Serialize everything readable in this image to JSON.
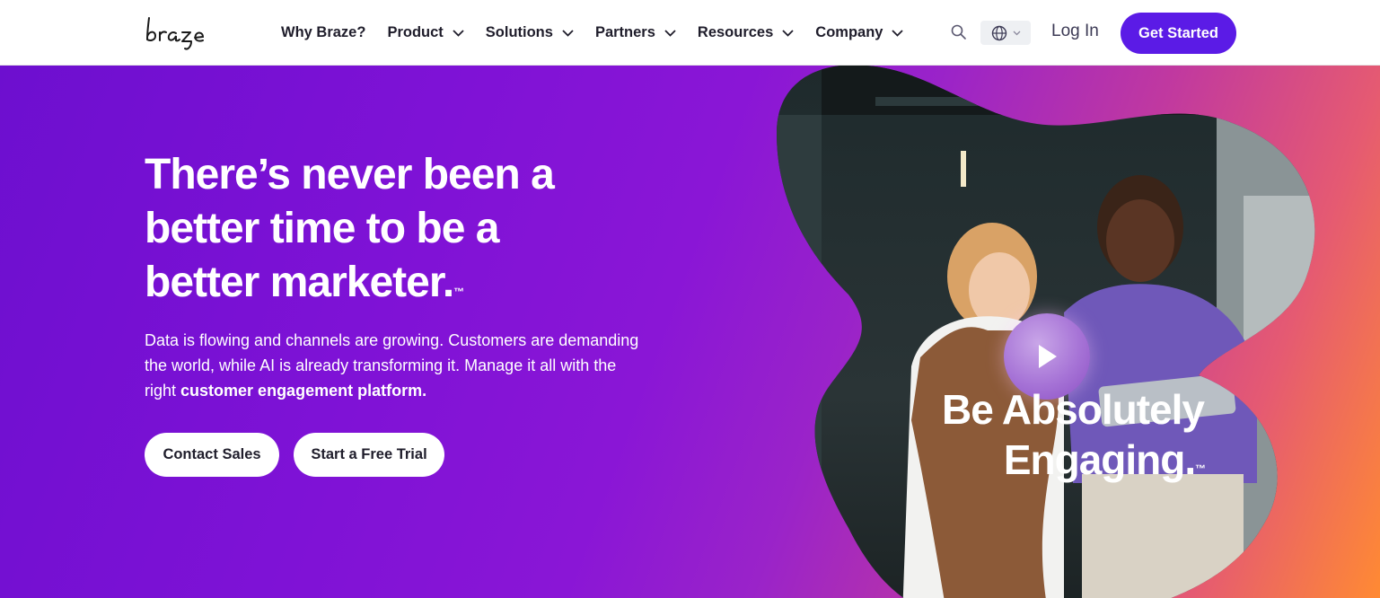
{
  "header": {
    "logo_text": "braze",
    "nav": [
      {
        "label": "Why Braze?",
        "has_dropdown": false
      },
      {
        "label": "Product",
        "has_dropdown": true
      },
      {
        "label": "Solutions",
        "has_dropdown": true
      },
      {
        "label": "Partners",
        "has_dropdown": true
      },
      {
        "label": "Resources",
        "has_dropdown": true
      },
      {
        "label": "Company",
        "has_dropdown": true
      }
    ],
    "search_icon": "search-icon",
    "language_icon": "globe-icon",
    "login_label": "Log In",
    "cta_label": "Get Started"
  },
  "hero": {
    "headline_line1": "There’s never been a",
    "headline_line2": "better time to be a",
    "headline_line3": "better marketer.",
    "headline_tm": "™",
    "sub_text": "Data is flowing and channels are growing. Customers are demanding the world, while AI is already transforming it. Manage it all with the right",
    "sub_bold": "customer engagement platform.",
    "btn_contact": "Contact Sales",
    "btn_trial": "Start a Free Trial"
  },
  "video": {
    "title_line1": "Be Absolutely",
    "title_line2": "Engaging.",
    "title_tm": "™",
    "play_icon": "play-icon"
  },
  "colors": {
    "brand_purple": "#5b1be6",
    "hero_start": "#6d0fcf",
    "hero_end": "#ff8a33"
  }
}
